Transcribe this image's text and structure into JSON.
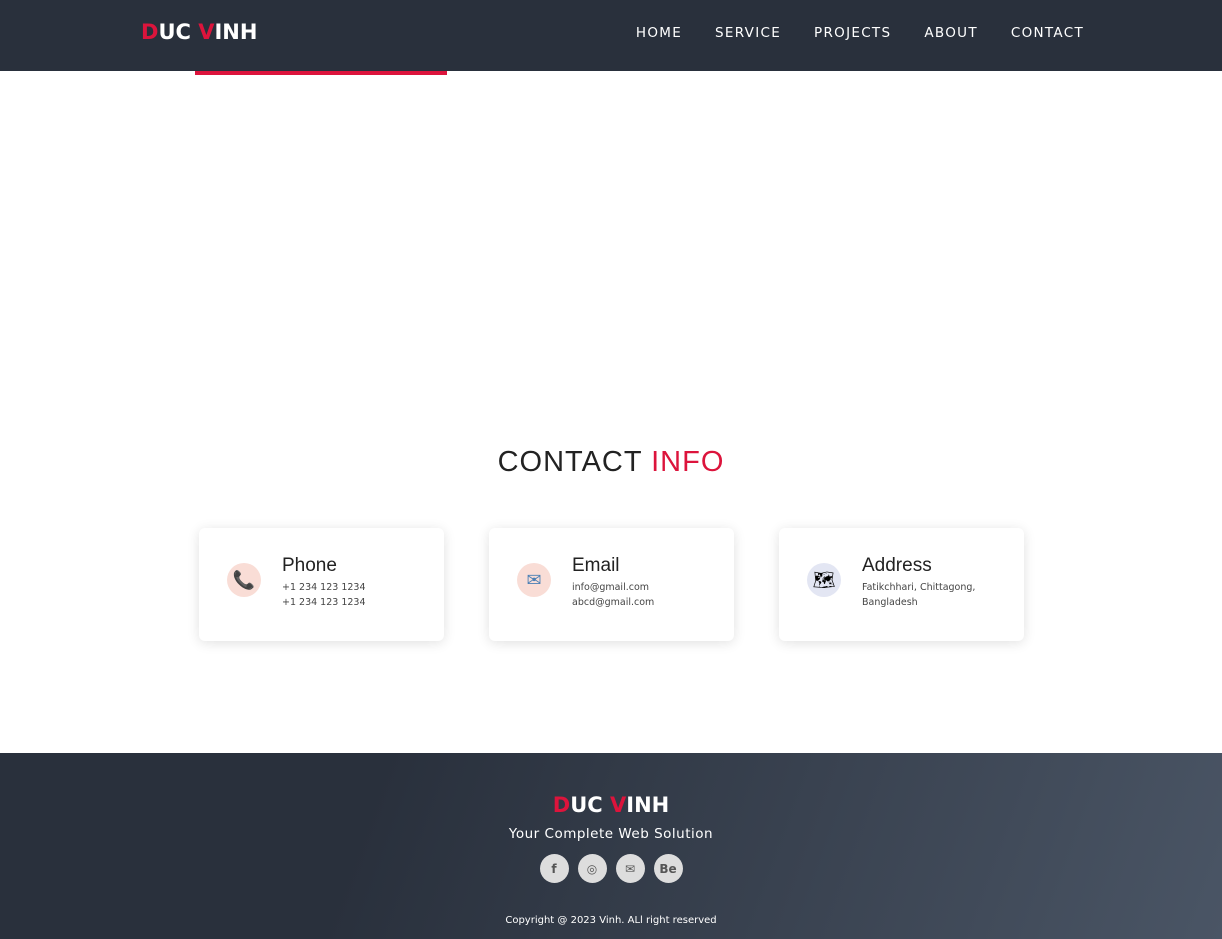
{
  "brand": {
    "first_initial": "D",
    "first_rest": "UC ",
    "second_initial": "V",
    "second_rest": "INH",
    "accent": "#dc143c"
  },
  "nav": {
    "items": [
      "HOME",
      "SERVICE",
      "PROJECTS",
      "ABOUT",
      "CONTACT"
    ]
  },
  "section": {
    "title_main": "CONTACT ",
    "title_accent": "INFO"
  },
  "cards": [
    {
      "title": "Phone",
      "line1": "+1 234 123 1234",
      "line2": "+1 234 123 1234",
      "icon": "phone-icon"
    },
    {
      "title": "Email",
      "line1": "info@gmail.com",
      "line2": "abcd@gmail.com",
      "icon": "envelope-icon"
    },
    {
      "title": "Address",
      "line1": "Fatikchhari, Chittagong,",
      "line2": "Bangladesh",
      "icon": "map-icon"
    }
  ],
  "footer": {
    "tagline": "Your Complete Web Solution",
    "social": [
      "f",
      "◎",
      "✉",
      "Be"
    ],
    "copyright": "Copyright @ 2023 Vinh. ALl right reserved"
  }
}
